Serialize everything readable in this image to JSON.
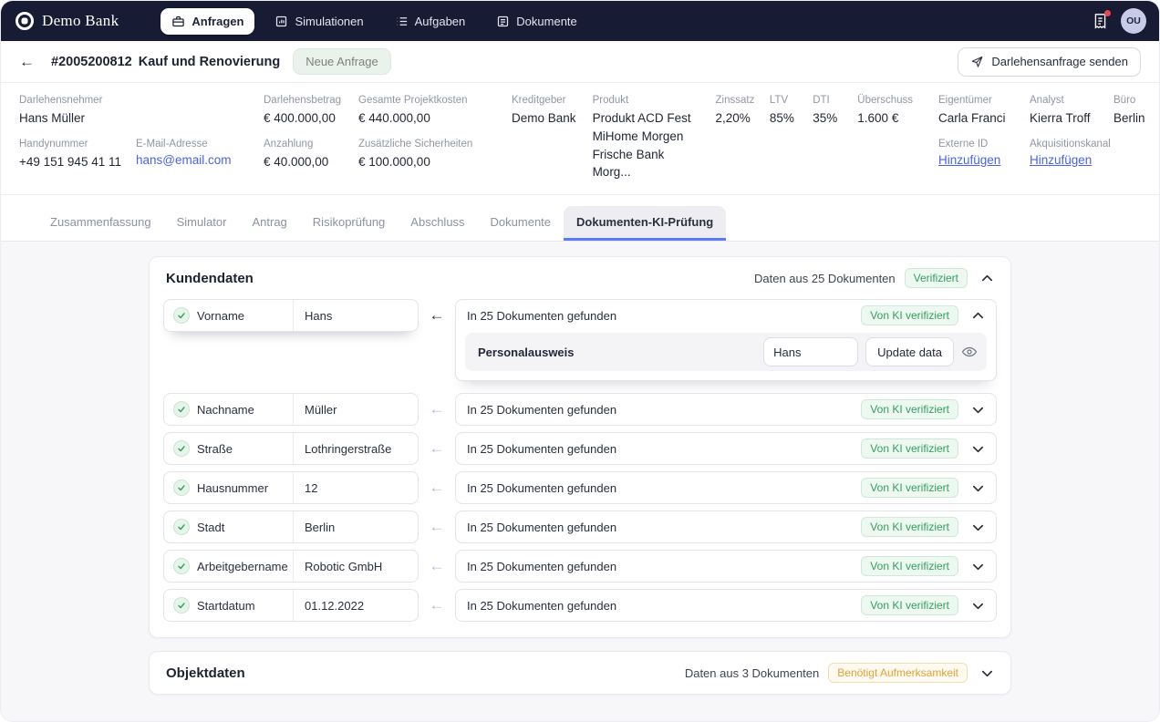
{
  "topnav": {
    "brand": "Demo Bank",
    "items": [
      {
        "label": "Anfragen",
        "icon": "briefcase-icon",
        "active": true
      },
      {
        "label": "Simulationen",
        "icon": "simulations-icon",
        "active": false
      },
      {
        "label": "Aufgaben",
        "icon": "tasks-list-icon",
        "active": false
      },
      {
        "label": "Dokumente",
        "icon": "documents-icon",
        "active": false
      }
    ],
    "notification_icon": "receipt-icon",
    "notification_dot_color": "#e5484d",
    "avatar_initials": "OU"
  },
  "header": {
    "back_icon": "←",
    "case_id": "#2005200812",
    "case_title": "Kauf und Renovierung",
    "status_badge": "Neue Anfrage",
    "send_button": "Darlehensanfrage senden",
    "send_icon": "paper-plane-icon"
  },
  "infobar": {
    "borrower": {
      "label": "Darlehensnehmer",
      "value": "Hans Müller"
    },
    "phone": {
      "label": "Handynummer",
      "value": "+49 151 945 41 11"
    },
    "email": {
      "label": "E-Mail-Adresse",
      "value": "hans@email.com"
    },
    "loan_amount": {
      "label": "Darlehensbetrag",
      "value": "€ 400.000,00"
    },
    "project_cost": {
      "label": "Gesamte Projektkosten",
      "value": "€ 440.000,00"
    },
    "down_payment": {
      "label": "Anzahlung",
      "value": "€ 40.000,00"
    },
    "additional_collateral": {
      "label": "Zusätzliche Sicherheiten",
      "value": "€ 100.000,00"
    },
    "lender": {
      "label": "Kreditgeber",
      "value": "Demo Bank"
    },
    "product": {
      "label": "Produkt",
      "lines": [
        "Produkt ACD Fest",
        "MiHome Morgen",
        "Frische Bank Morg..."
      ]
    },
    "interest": {
      "label": "Zinssatz",
      "value": "2,20%"
    },
    "ltv": {
      "label": "LTV",
      "value": "85%"
    },
    "dti": {
      "label": "DTI",
      "value": "35%"
    },
    "surplus": {
      "label": "Überschuss",
      "value": "1.600 €"
    },
    "owner": {
      "label": "Eigentümer",
      "value": "Carla Franci"
    },
    "analyst": {
      "label": "Analyst",
      "value": "Kierra Troff"
    },
    "office": {
      "label": "Büro",
      "value": "Berlin"
    },
    "external_id": {
      "label": "Externe ID",
      "link": "Hinzufügen"
    },
    "acquisition_channel": {
      "label": "Akquisitionskanal",
      "link": "Hinzufügen"
    }
  },
  "tabs": [
    {
      "label": "Zusammenfassung",
      "active": false
    },
    {
      "label": "Simulator",
      "active": false
    },
    {
      "label": "Antrag",
      "active": false
    },
    {
      "label": "Risikoprüfung",
      "active": false
    },
    {
      "label": "Abschluss",
      "active": false
    },
    {
      "label": "Dokumente",
      "active": false
    },
    {
      "label": "Dokumenten-KI-Prüfung",
      "active": true
    }
  ],
  "kundendaten": {
    "title": "Kundendaten",
    "meta": "Daten aus 25 Dokumenten",
    "badge": "Verifiziert",
    "collapse_icon": "chevron-up-icon",
    "found_arrow": "←",
    "rows": [
      {
        "label": "Vorname",
        "value": "Hans",
        "found": "In 25 Dokumenten gefunden",
        "badge": "Von KI verifiziert",
        "expanded": true,
        "doc": {
          "name": "Personalausweis",
          "input_value": "Hans",
          "button": "Update data",
          "eye_icon": "eye-icon"
        }
      },
      {
        "label": "Nachname",
        "value": "Müller",
        "found": "In 25 Dokumenten gefunden",
        "badge": "Von KI verifiziert",
        "expanded": false
      },
      {
        "label": "Straße",
        "value": "Lothringerstraße",
        "found": "In 25 Dokumenten gefunden",
        "badge": "Von KI verifiziert",
        "expanded": false
      },
      {
        "label": "Hausnummer",
        "value": "12",
        "found": "In 25 Dokumenten gefunden",
        "badge": "Von KI verifiziert",
        "expanded": false
      },
      {
        "label": "Stadt",
        "value": "Berlin",
        "found": "In 25 Dokumenten gefunden",
        "badge": "Von KI verifiziert",
        "expanded": false
      },
      {
        "label": "Arbeitgebername",
        "value": "Robotic GmbH",
        "found": "In 25 Dokumenten gefunden",
        "badge": "Von KI verifiziert",
        "expanded": false
      },
      {
        "label": "Startdatum",
        "value": "01.12.2022",
        "found": "In 25 Dokumenten gefunden",
        "badge": "Von KI verifiziert",
        "expanded": false
      }
    ]
  },
  "objektdaten": {
    "title": "Objektdaten",
    "meta": "Daten aus 3 Dokumenten",
    "badge": "Benötigt Aufmerksamkeit",
    "collapse_icon": "chevron-down-icon"
  },
  "colors": {
    "nav_bg": "#171b33",
    "accent_blue": "#4a63e7",
    "tab_underline": "#5b7af5",
    "verified_green": "#33a05f",
    "attention_amber": "#dfa23a",
    "page_bg": "#f7f7fa"
  }
}
